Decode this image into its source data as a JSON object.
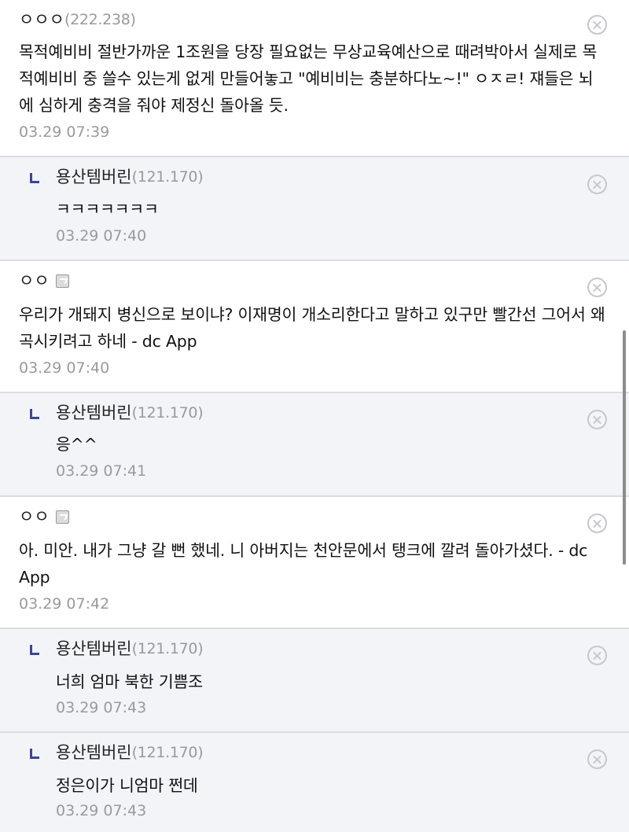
{
  "comments": [
    {
      "type": "comment",
      "nickname": "ㅇㅇㅇ",
      "ip": "(222.238)",
      "text": "목적예비비 절반가까운 1조원을 당장 필요없는 무상교육예산으로 때려박아서 실제로 목적예비비 중 쓸수 있는게 없게 만들어놓고 \"예비비는 충분하다노~!\" ㅇㅈㄹ! 쟤들은 뇌에 심하게 충격을 줘야 제정신 돌아올 듯.",
      "time": "03.29 07:39"
    },
    {
      "type": "reply",
      "nickname": "용산템버린",
      "ip": "(121.170)",
      "text": "ㅋㅋㅋㅋㅋㅋㅋ",
      "time": "03.29 07:40"
    },
    {
      "type": "comment",
      "nickname": "ㅇㅇ",
      "ip": "",
      "text": "우리가 개돼지 병신으로 보이냐? 이재명이 개소리한다고 말하고 있구만 빨간선 그어서 왜곡시키려고 하네 - dc App",
      "time": "03.29 07:40"
    },
    {
      "type": "reply",
      "nickname": "용산템버린",
      "ip": "(121.170)",
      "text": "응^^",
      "time": "03.29 07:41"
    },
    {
      "type": "comment",
      "nickname": "ㅇㅇ",
      "ip": "",
      "text": "아. 미안. 내가 그냥 갈 뻔 했네. 니 아버지는 천안문에서 탱크에 깔려 돌아가셨다. - dc App",
      "time": "03.29 07:42"
    },
    {
      "type": "reply",
      "nickname": "용산템버린",
      "ip": "(121.170)",
      "text": "너희 엄마 북한 기쁨조",
      "time": "03.29 07:43"
    },
    {
      "type": "reply",
      "nickname": "용산템버린",
      "ip": "(121.170)",
      "text": "정은이가 니엄마 쩐데",
      "time": "03.29 07:43"
    }
  ]
}
